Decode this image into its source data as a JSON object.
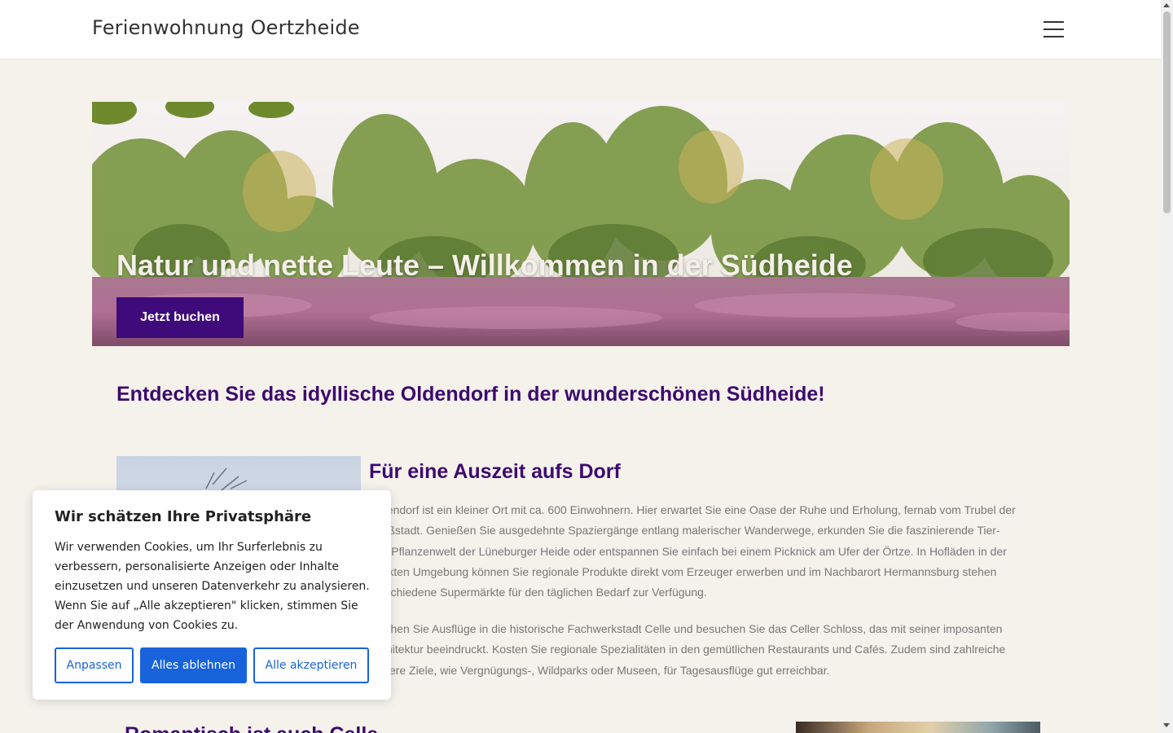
{
  "header": {
    "site_title": "Ferienwohnung Oertzheide",
    "menu_icon": "hamburger-menu-icon"
  },
  "hero": {
    "title": "Natur und nette Leute – Willkommen in der Südheide",
    "button_label": "Jetzt buchen",
    "button_color": "#3f0a7a"
  },
  "main": {
    "section_heading": "Entdecken Sie das idyllische Oldendorf in der wunderschönen Südheide!",
    "sub_heading": "Für eine Auszeit aufs Dorf",
    "paragraph_1": "Oldendorf ist ein kleiner Ort mit ca. 600 Einwohnern. Hier erwartet Sie eine Oase der Ruhe und Erholung, fernab vom Trubel der Großstadt. Genießen Sie ausgedehnte Spaziergänge entlang malerischer Wanderwege, erkunden Sie die faszinierende Tier- und Pflanzenwelt der Lüneburger Heide oder entspannen Sie einfach bei einem Picknick am Ufer der Örtze. In Hofläden in der direkten Umgebung können Sie regionale Produkte direkt vom Erzeuger erwerben und im Nachbarort Hermannsburg stehen verschiedene Supermärkte für den täglichen Bedarf zur Verfügung.",
    "paragraph_2": "Machen Sie Ausflüge in die historische Fachwerkstadt Celle und besuchen Sie das Celler Schloss, das mit seiner imposanten Architektur beeindruckt. Kosten Sie regionale Spezialitäten in den gemütlichen Restaurants und Cafés. Zudem sind zahlreiche weitere Ziele, wie Vergnügungs-, Wildparks oder Museen, für Tagesausflüge gut erreichbar.",
    "bottom_heading": "Romantisch ist auch Celle",
    "heading_color": "#3d0a6e"
  },
  "cookie_banner": {
    "title": "Wir schätzen Ihre Privatsphäre",
    "text": "Wir verwenden Cookies, um Ihr Surferlebnis zu verbessern, personalisierte Anzeigen oder Inhalte einzusetzen und unseren Datenverkehr zu analysieren. Wenn Sie auf „Alle akzeptieren\" klicken, stimmen Sie der Anwendung von Cookies zu.",
    "btn_customize": "Anpassen",
    "btn_reject": "Alles ablehnen",
    "btn_accept": "Alle akzeptieren",
    "accent_color": "#1863dc"
  }
}
